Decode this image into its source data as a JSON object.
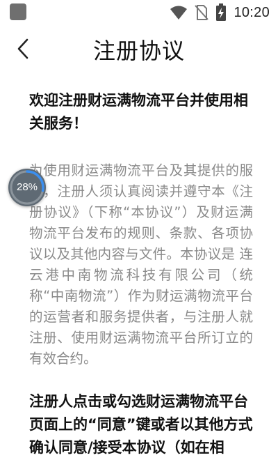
{
  "status_bar": {
    "time": "10:20",
    "icons": [
      "app-notification-icon",
      "wifi-icon",
      "no-sim-icon",
      "battery-charging-icon"
    ]
  },
  "header": {
    "title": "注册协议",
    "back_icon": "chevron-left-icon"
  },
  "content": {
    "heading_1": "欢迎注册财运满物流平台并使用相关服务！",
    "paragraph_1": "为使用财运满物流平台及其提供的服务，注册人须认真阅读并遵守本《注册协议》（下称“本协议”）及财运满物流平台发布的规则、条款、各项协议以及其他内容与文件。本协议是 连云港中南物流科技有限公司（统称“中南物流”）作为财运满物流平台的运营者和服务提供者，与注册人就注册、使用财运满物流平台所订立的有效合约。",
    "heading_2": "注册人点击或勾选财运满物流平台页面上的“同意”键或者以其他方式确认同意/接受本协议（如在相"
  },
  "floating_widget": {
    "progress_label": "28%",
    "progress_value": 0.28,
    "ring_color": "#3b8ff0",
    "bg_color": "#5f6a74"
  }
}
